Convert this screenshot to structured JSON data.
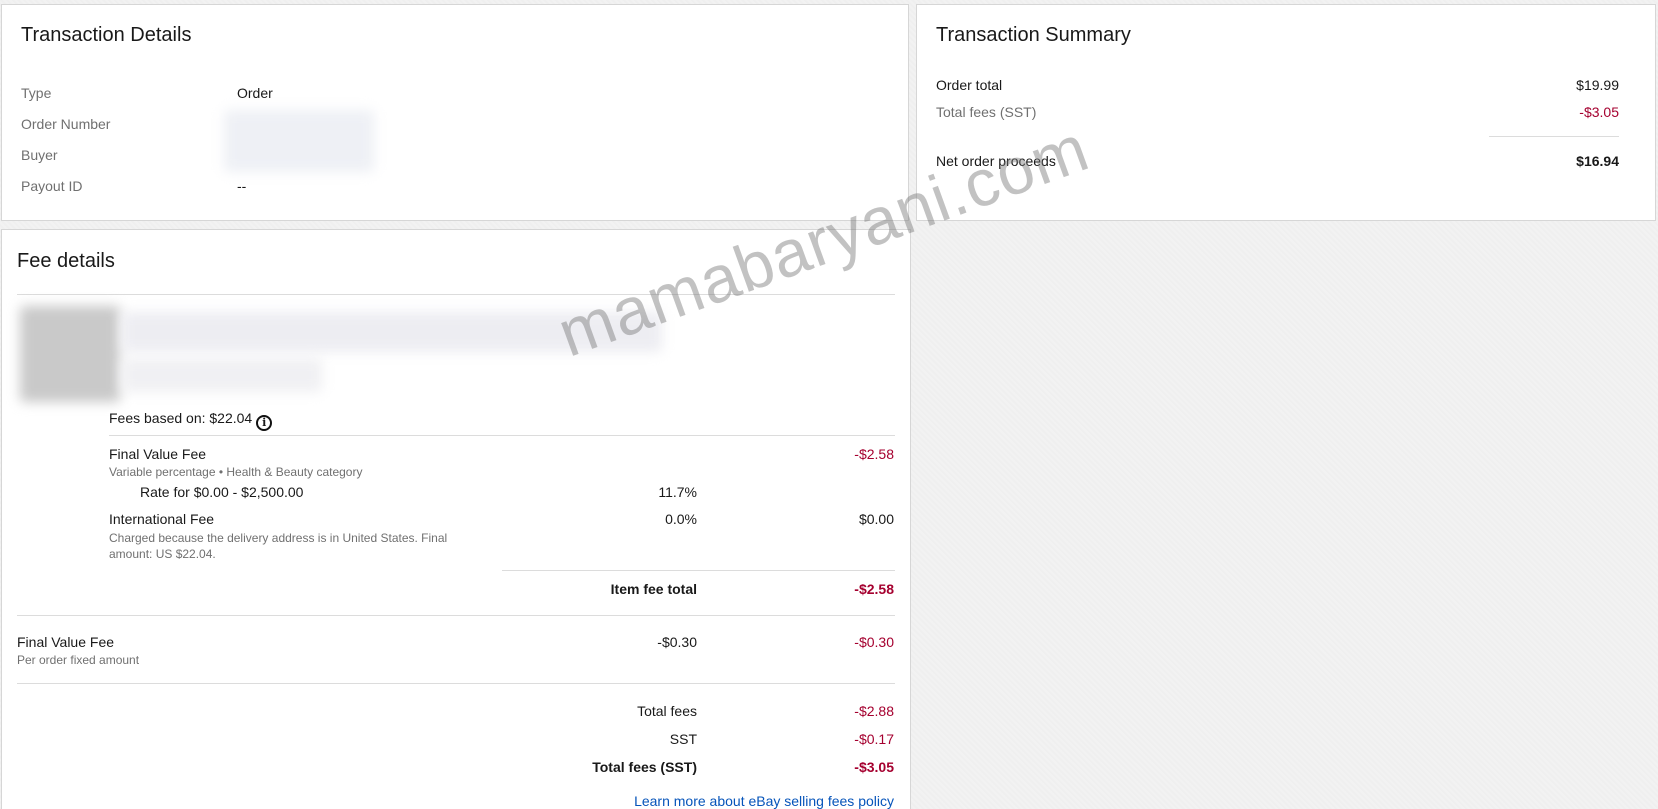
{
  "transaction_details": {
    "title": "Transaction Details",
    "rows": [
      {
        "label": "Type",
        "value": "Order"
      },
      {
        "label": "Order Number",
        "value": ""
      },
      {
        "label": "Buyer",
        "value": ""
      },
      {
        "label": "Payout ID",
        "value": "--"
      }
    ]
  },
  "transaction_summary": {
    "title": "Transaction Summary",
    "order_total_label": "Order total",
    "order_total_value": "$19.99",
    "total_fees_label": "Total fees (SST)",
    "total_fees_value": "-$3.05",
    "net_label": "Net order proceeds",
    "net_value": "$16.94"
  },
  "fee_details": {
    "title": "Fee details",
    "fees_based_on": "Fees based on: $22.04",
    "info_icon_glyph": "i",
    "final_value_fee": {
      "label": "Final Value Fee",
      "sub": "Variable percentage • Health & Beauty category",
      "amount": "-$2.58",
      "rate_label": "Rate for $0.00 - $2,500.00",
      "rate_value": "11.7%"
    },
    "international_fee": {
      "label": "International Fee",
      "sub": "Charged because the delivery address is in United States. Final amount: US $22.04.",
      "rate": "0.0%",
      "amount": "$0.00"
    },
    "item_fee_total_label": "Item fee total",
    "item_fee_total_value": "-$2.58",
    "order_fvf": {
      "label": "Final Value Fee",
      "sub": "Per order fixed amount",
      "rate": "-$0.30",
      "amount": "-$0.30"
    },
    "totals": {
      "total_fees_label": "Total fees",
      "total_fees_value": "-$2.88",
      "sst_label": "SST",
      "sst_value": "-$0.17",
      "total_sst_label": "Total fees (SST)",
      "total_sst_value": "-$3.05"
    },
    "learn_more": "Learn more about eBay selling fees policy"
  },
  "watermark": "mamabaryani.com",
  "colors": {
    "negative": "#a5002f",
    "link": "#0654ba"
  }
}
